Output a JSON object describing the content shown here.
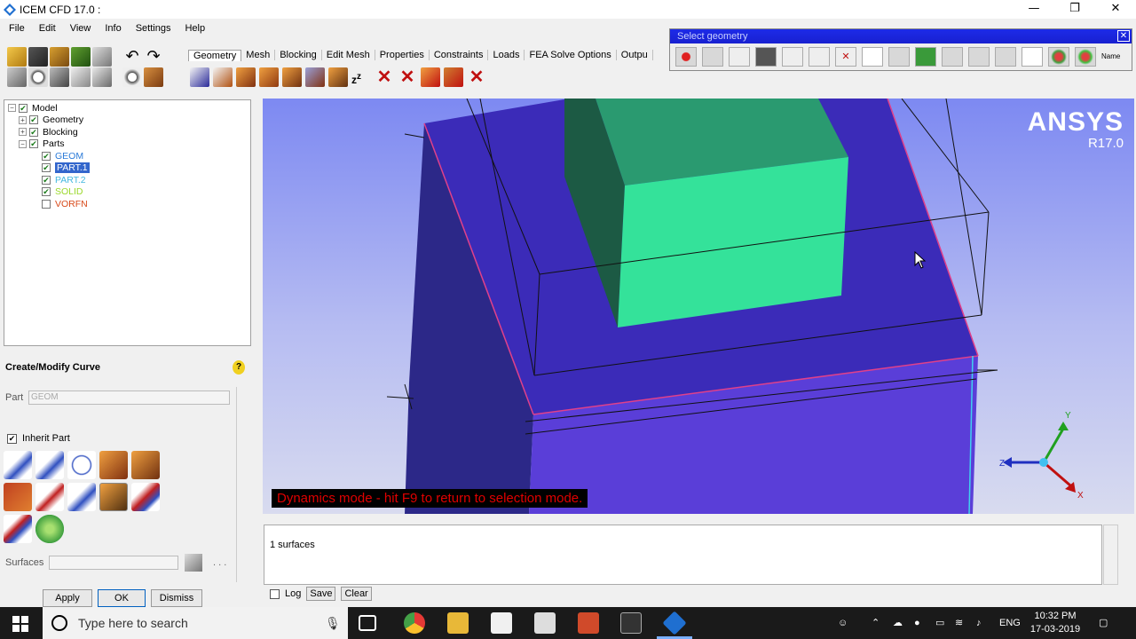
{
  "window": {
    "title": "ICEM CFD 17.0 :",
    "controls": [
      "—",
      "❐",
      "✕"
    ]
  },
  "menu": [
    "File",
    "Edit",
    "View",
    "Info",
    "Settings",
    "Help"
  ],
  "tabs": [
    "Geometry",
    "Mesh",
    "Blocking",
    "Edit Mesh",
    "Properties",
    "Constraints",
    "Loads",
    "FEA Solve Options",
    "Outpu"
  ],
  "select_geometry": {
    "title": "Select geometry",
    "close": "✕",
    "name_label": "Name"
  },
  "tree": {
    "root": "Model",
    "items": [
      {
        "label": "Geometry",
        "level": 1
      },
      {
        "label": "Blocking",
        "level": 1
      },
      {
        "label": "Parts",
        "level": 1
      }
    ],
    "parts": [
      {
        "label": "GEOM",
        "color": "#2a7ad8",
        "checked": true,
        "selected": false
      },
      {
        "label": "PART.1",
        "color": "#ffffff",
        "checked": true,
        "selected": true
      },
      {
        "label": "PART.2",
        "color": "#44b8e0",
        "checked": true,
        "selected": false
      },
      {
        "label": "SOLID",
        "color": "#9ad82a",
        "checked": true,
        "selected": false
      },
      {
        "label": "VORFN",
        "color": "#d84a1a",
        "checked": false,
        "selected": false
      }
    ]
  },
  "panel": {
    "title": "Create/Modify Curve",
    "help": "?",
    "part_label": "Part",
    "part_value": "GEOM",
    "inherit_label": "Inherit Part",
    "surfaces_label": "Surfaces",
    "dots": ". . ."
  },
  "buttons": {
    "apply": "Apply",
    "ok": "OK",
    "dismiss": "Dismiss"
  },
  "viewport": {
    "brand": "ANSYS",
    "version": "R17.0",
    "status": "Dynamics mode - hit F9 to return to selection mode.",
    "axes": {
      "x": "X",
      "y": "Y",
      "z": "Z"
    }
  },
  "messages": {
    "text": "1 surfaces",
    "log_label": "Log",
    "save_label": "Save",
    "clear_label": "Clear"
  },
  "taskbar": {
    "search_placeholder": "Type here to search",
    "language": "ENG",
    "time": "10:32 PM",
    "date": "17-03-2019"
  }
}
